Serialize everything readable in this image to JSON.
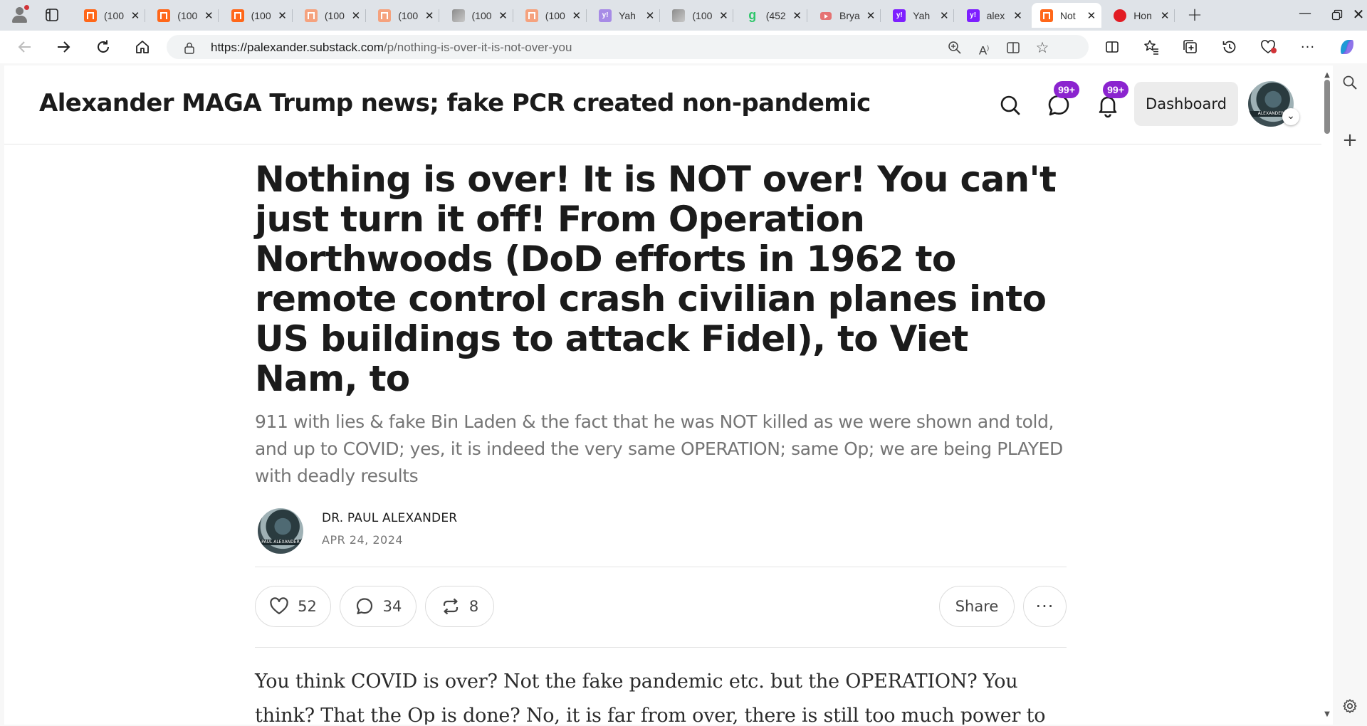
{
  "browser": {
    "tabs": [
      {
        "title": "(100",
        "favicon": "substack-icon",
        "style": "sub"
      },
      {
        "title": "(100",
        "favicon": "substack-icon",
        "style": "sub"
      },
      {
        "title": "(100",
        "favicon": "substack-icon",
        "style": "sub"
      },
      {
        "title": "(100",
        "favicon": "substack-icon",
        "style": "sub faded"
      },
      {
        "title": "(100",
        "favicon": "substack-icon",
        "style": "sub faded"
      },
      {
        "title": "(100",
        "favicon": "photo-icon",
        "style": "img"
      },
      {
        "title": "(100",
        "favicon": "substack-icon",
        "style": "sub faded"
      },
      {
        "title": "Yah",
        "favicon": "yahoo-icon",
        "style": "yahoo faded"
      },
      {
        "title": "(100",
        "favicon": "photo-icon",
        "style": "img"
      },
      {
        "title": "(452",
        "favicon": "g-icon",
        "style": "gq"
      },
      {
        "title": "Brya",
        "favicon": "youtube-icon",
        "style": "yt"
      },
      {
        "title": "Yah",
        "favicon": "yahoo-icon",
        "style": "yahoo"
      },
      {
        "title": "alex",
        "favicon": "yahoo-icon",
        "style": "yahoo"
      },
      {
        "title": "Not",
        "favicon": "substack-icon",
        "style": "sub",
        "active": true
      },
      {
        "title": "Hon",
        "favicon": "red-icon",
        "style": "red"
      }
    ],
    "url_host": "https://palexander.substack.com",
    "url_path": "/p/nothing-is-over-it-is-not-over-you"
  },
  "site": {
    "title": "Alexander MAGA Trump news; fake PCR created non-pandemic",
    "chat_badge": "99+",
    "notifications_badge": "99+",
    "dashboard_label": "Dashboard",
    "avatar_caption": "ALEXANDER"
  },
  "article": {
    "headline": "Nothing is over! It is NOT over! You can't just turn it off! From Operation Northwoods (DoD efforts in 1962 to remote control crash civilian planes into US buildings to attack Fidel), to Viet Nam, to",
    "subtitle": "911 with lies & fake Bin Laden & the fact that he was NOT killed as we were shown and told, and up to COVID; yes, it is indeed the very same OPERATION; same Op; we are being PLAYED with deadly results",
    "author": "DR. PAUL ALEXANDER",
    "author_avatar_caption": "PAUL ALEXANDER",
    "date": "APR 24, 2024",
    "likes": "52",
    "comments": "34",
    "restacks": "8",
    "share_label": "Share",
    "body": "You think COVID is over? Not the fake pandemic etc. but the OPERATION? You think? That the Op is done? No, it is far from over, there is still too much power to"
  }
}
